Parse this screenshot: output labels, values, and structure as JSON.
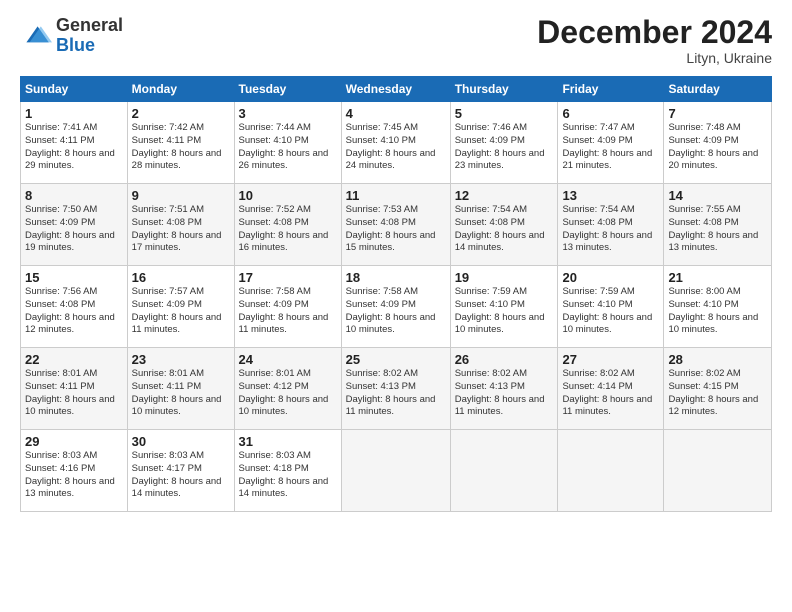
{
  "header": {
    "logo_general": "General",
    "logo_blue": "Blue",
    "month_title": "December 2024",
    "location": "Lityn, Ukraine"
  },
  "days_of_week": [
    "Sunday",
    "Monday",
    "Tuesday",
    "Wednesday",
    "Thursday",
    "Friday",
    "Saturday"
  ],
  "weeks": [
    [
      {
        "day": "1",
        "sunrise": "7:41 AM",
        "sunset": "4:11 PM",
        "daylight": "8 hours and 29 minutes."
      },
      {
        "day": "2",
        "sunrise": "7:42 AM",
        "sunset": "4:11 PM",
        "daylight": "8 hours and 28 minutes."
      },
      {
        "day": "3",
        "sunrise": "7:44 AM",
        "sunset": "4:10 PM",
        "daylight": "8 hours and 26 minutes."
      },
      {
        "day": "4",
        "sunrise": "7:45 AM",
        "sunset": "4:10 PM",
        "daylight": "8 hours and 24 minutes."
      },
      {
        "day": "5",
        "sunrise": "7:46 AM",
        "sunset": "4:09 PM",
        "daylight": "8 hours and 23 minutes."
      },
      {
        "day": "6",
        "sunrise": "7:47 AM",
        "sunset": "4:09 PM",
        "daylight": "8 hours and 21 minutes."
      },
      {
        "day": "7",
        "sunrise": "7:48 AM",
        "sunset": "4:09 PM",
        "daylight": "8 hours and 20 minutes."
      }
    ],
    [
      {
        "day": "8",
        "sunrise": "7:50 AM",
        "sunset": "4:09 PM",
        "daylight": "8 hours and 19 minutes."
      },
      {
        "day": "9",
        "sunrise": "7:51 AM",
        "sunset": "4:08 PM",
        "daylight": "8 hours and 17 minutes."
      },
      {
        "day": "10",
        "sunrise": "7:52 AM",
        "sunset": "4:08 PM",
        "daylight": "8 hours and 16 minutes."
      },
      {
        "day": "11",
        "sunrise": "7:53 AM",
        "sunset": "4:08 PM",
        "daylight": "8 hours and 15 minutes."
      },
      {
        "day": "12",
        "sunrise": "7:54 AM",
        "sunset": "4:08 PM",
        "daylight": "8 hours and 14 minutes."
      },
      {
        "day": "13",
        "sunrise": "7:54 AM",
        "sunset": "4:08 PM",
        "daylight": "8 hours and 13 minutes."
      },
      {
        "day": "14",
        "sunrise": "7:55 AM",
        "sunset": "4:08 PM",
        "daylight": "8 hours and 13 minutes."
      }
    ],
    [
      {
        "day": "15",
        "sunrise": "7:56 AM",
        "sunset": "4:08 PM",
        "daylight": "8 hours and 12 minutes."
      },
      {
        "day": "16",
        "sunrise": "7:57 AM",
        "sunset": "4:09 PM",
        "daylight": "8 hours and 11 minutes."
      },
      {
        "day": "17",
        "sunrise": "7:58 AM",
        "sunset": "4:09 PM",
        "daylight": "8 hours and 11 minutes."
      },
      {
        "day": "18",
        "sunrise": "7:58 AM",
        "sunset": "4:09 PM",
        "daylight": "8 hours and 10 minutes."
      },
      {
        "day": "19",
        "sunrise": "7:59 AM",
        "sunset": "4:10 PM",
        "daylight": "8 hours and 10 minutes."
      },
      {
        "day": "20",
        "sunrise": "7:59 AM",
        "sunset": "4:10 PM",
        "daylight": "8 hours and 10 minutes."
      },
      {
        "day": "21",
        "sunrise": "8:00 AM",
        "sunset": "4:10 PM",
        "daylight": "8 hours and 10 minutes."
      }
    ],
    [
      {
        "day": "22",
        "sunrise": "8:01 AM",
        "sunset": "4:11 PM",
        "daylight": "8 hours and 10 minutes."
      },
      {
        "day": "23",
        "sunrise": "8:01 AM",
        "sunset": "4:11 PM",
        "daylight": "8 hours and 10 minutes."
      },
      {
        "day": "24",
        "sunrise": "8:01 AM",
        "sunset": "4:12 PM",
        "daylight": "8 hours and 10 minutes."
      },
      {
        "day": "25",
        "sunrise": "8:02 AM",
        "sunset": "4:13 PM",
        "daylight": "8 hours and 11 minutes."
      },
      {
        "day": "26",
        "sunrise": "8:02 AM",
        "sunset": "4:13 PM",
        "daylight": "8 hours and 11 minutes."
      },
      {
        "day": "27",
        "sunrise": "8:02 AM",
        "sunset": "4:14 PM",
        "daylight": "8 hours and 11 minutes."
      },
      {
        "day": "28",
        "sunrise": "8:02 AM",
        "sunset": "4:15 PM",
        "daylight": "8 hours and 12 minutes."
      }
    ],
    [
      {
        "day": "29",
        "sunrise": "8:03 AM",
        "sunset": "4:16 PM",
        "daylight": "8 hours and 13 minutes."
      },
      {
        "day": "30",
        "sunrise": "8:03 AM",
        "sunset": "4:17 PM",
        "daylight": "8 hours and 14 minutes."
      },
      {
        "day": "31",
        "sunrise": "8:03 AM",
        "sunset": "4:18 PM",
        "daylight": "8 hours and 14 minutes."
      },
      null,
      null,
      null,
      null
    ]
  ]
}
